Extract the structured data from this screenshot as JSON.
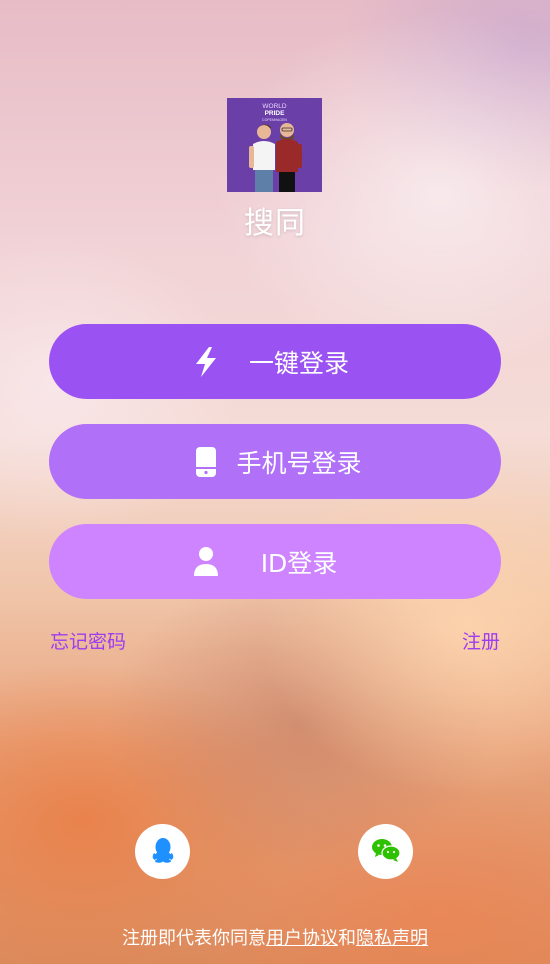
{
  "app": {
    "name": "搜同",
    "logo_text": {
      "line1": "WORLD",
      "line2": "PRIDE",
      "line3": "COPENHAGEN"
    }
  },
  "buttons": {
    "quick_login": "一键登录",
    "phone_login": "手机号登录",
    "id_login": "ID登录"
  },
  "links": {
    "forgot_password": "忘记密码",
    "register": "注册"
  },
  "terms": {
    "prefix": "注册即代表你同意",
    "user_agreement": "用户协议",
    "and": "和",
    "privacy": "隐私声明"
  },
  "colors": {
    "quick": "#9b52f2",
    "phone": "#b070f8",
    "id": "#cf84ff",
    "link": "#9d3cf0",
    "qq": "#1e90ff",
    "wechat": "#2dc100"
  },
  "icons": [
    "lightning-icon",
    "phone-icon",
    "user-icon",
    "qq-icon",
    "wechat-icon"
  ]
}
